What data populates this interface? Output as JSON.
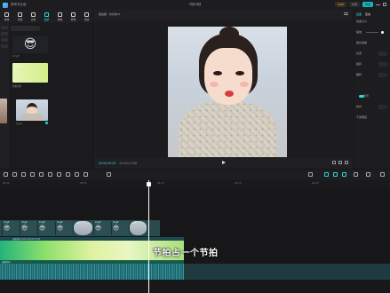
{
  "window": {
    "app_name": "剪映专业版",
    "document_title": "7月23日",
    "buttons": [
      "SVIP",
      "分享",
      "导出"
    ]
  },
  "media_tabs": [
    {
      "label": "媒体",
      "active": false
    },
    {
      "label": "音频",
      "active": false
    },
    {
      "label": "文本",
      "active": false
    },
    {
      "label": "贴纸",
      "active": true
    },
    {
      "label": "特效",
      "active": false
    },
    {
      "label": "转场",
      "active": false
    },
    {
      "label": "滤镜",
      "active": false
    }
  ],
  "media": {
    "thumb1_caption": "13.gif",
    "thumb2_caption": "绿幕素材",
    "thumb3_caption": "9.jpg",
    "emoji": "😎"
  },
  "player": {
    "title": "播放器 · 时间线01",
    "timecode_current": "00:00:00:00",
    "timecode_total": "00:00:13:06"
  },
  "inspector": {
    "tabs": [
      "画面",
      "变速"
    ],
    "sub": "位置大小",
    "rows": [
      "缩放",
      "等比缩放",
      "位置",
      "旋转",
      "翻转",
      "背景",
      "不透明度"
    ],
    "bg_label": "样式"
  },
  "timeline": {
    "ruler": [
      "00:00",
      "00:05",
      "00:10",
      "00:15",
      "00:20"
    ],
    "marker_label": "1",
    "stickers": [
      {
        "label": "13.gif",
        "emoji": "😎"
      },
      {
        "label": "13.gif",
        "emoji": "😎"
      },
      {
        "label": "13.gif",
        "emoji": "😎"
      },
      {
        "label": "13.gif",
        "emoji": "😎"
      },
      {
        "label": "9.jpg",
        "emoji": ""
      },
      {
        "label": "13.gif",
        "emoji": "😎"
      },
      {
        "label": "13.gif",
        "emoji": "😎"
      },
      {
        "label": "15.gif",
        "emoji": ""
      }
    ],
    "main_track_label": "绿幕素材.mp4  00:00:13:06",
    "green_caption": "绿幕素材",
    "subtitle": "节拍占一个节拍"
  },
  "colors": {
    "accent": "#2ad8e0",
    "lips": "#d93a3e"
  }
}
